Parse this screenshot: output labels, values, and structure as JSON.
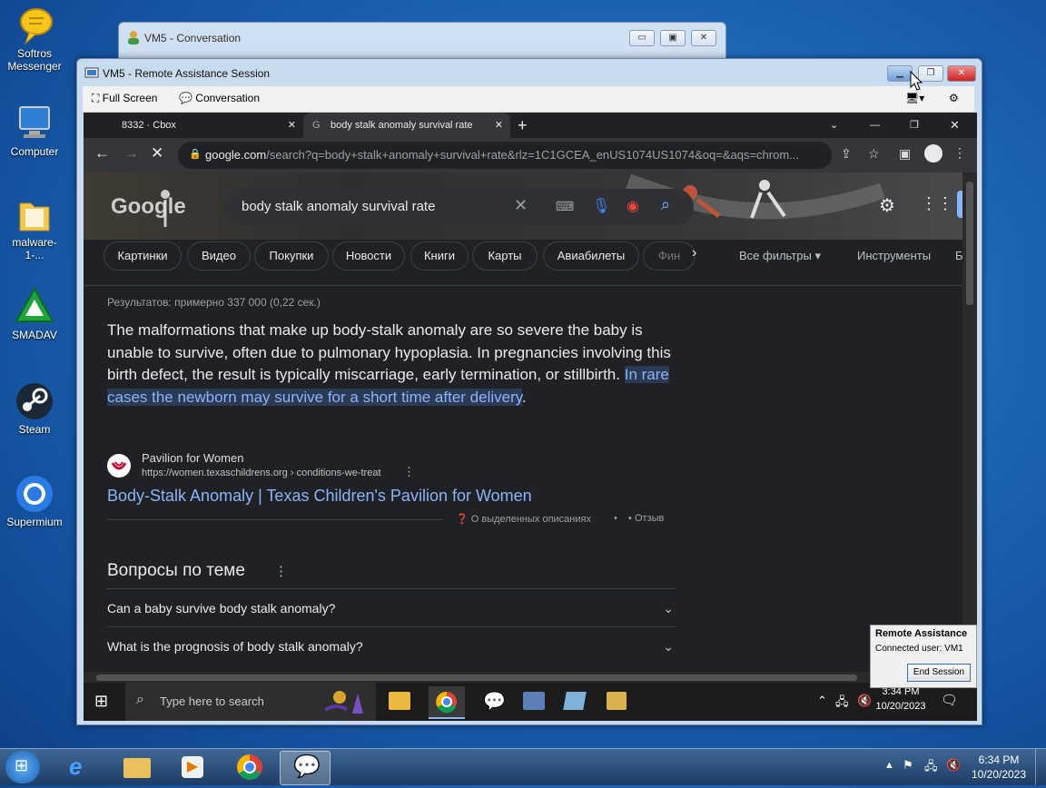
{
  "desktop_icons": [
    {
      "label": "Softros\nMessenger",
      "icon": "softros-messenger-icon"
    },
    {
      "label": "Computer",
      "icon": "computer-icon"
    },
    {
      "label": "malware-1-...",
      "icon": "folder-icon"
    },
    {
      "label": "SMADAV",
      "icon": "smadav-icon"
    },
    {
      "label": "Steam",
      "icon": "steam-icon"
    },
    {
      "label": "Supermium",
      "icon": "supermium-icon"
    }
  ],
  "conversation_window": {
    "title": "VM5 - Conversation"
  },
  "ra_window": {
    "title": "VM5 - Remote Assistance Session",
    "toolbar": {
      "full_screen": "Full Screen",
      "conversation": "Conversation"
    }
  },
  "chrome": {
    "tabs": [
      {
        "label": "8332 · Cbox",
        "active": false
      },
      {
        "label": "body stalk anomaly survival rate",
        "active": true
      }
    ],
    "url_domain": "google.com",
    "url_rest": "/search?q=body+stalk+anomaly+survival+rate&rlz=1C1GCEA_enUS1074US1074&oq=&aqs=chrom..."
  },
  "google": {
    "logo": "Google",
    "query": "body stalk anomaly survival rate",
    "chips": [
      "Картинки",
      "Видео",
      "Покупки",
      "Новости",
      "Книги",
      "Карты",
      "Авиабилеты",
      "Фин"
    ],
    "all_filters": "Все фильтры",
    "tools": "Инструменты",
    "extra": "Б",
    "results_count": "Результатов: примерно 337 000 (0,22 сек.)",
    "snippet_plain": "The malformations that make up body-stalk anomaly are so severe the baby is unable to survive, often due to pulmonary hypoplasia. In pregnancies involving this birth defect, the result is typically miscarriage, early termination, or stillbirth. ",
    "snippet_highlight": "In rare cases the newborn may survive for a short time after delivery",
    "snippet_end": ".",
    "source_name": "Pavilion for Women",
    "source_url": "https://women.texaschildrens.org › conditions-we-treat",
    "result_title": "Body-Stalk Anomaly | Texas Children's Pavilion for Women",
    "about_snippets": "О выделенных описаниях",
    "feedback": "Отзыв",
    "related_heading": "Вопросы по теме",
    "questions": [
      "Can a baby survive body stalk anomaly?",
      "What is the prognosis of body stalk anomaly?"
    ]
  },
  "inner_taskbar": {
    "search_placeholder": "Type here to search",
    "time": "3:34 PM",
    "date": "10/20/2023"
  },
  "ra_popup": {
    "title": "Remote Assistance",
    "connected": "Connected user: VM1",
    "end_session": "End Session"
  },
  "taskbar": {
    "time": "6:34 PM",
    "date": "10/20/2023"
  },
  "colors": {
    "link": "#8ab4f8",
    "highlight_bg": "#2b3a55",
    "page_bg": "#202124"
  }
}
